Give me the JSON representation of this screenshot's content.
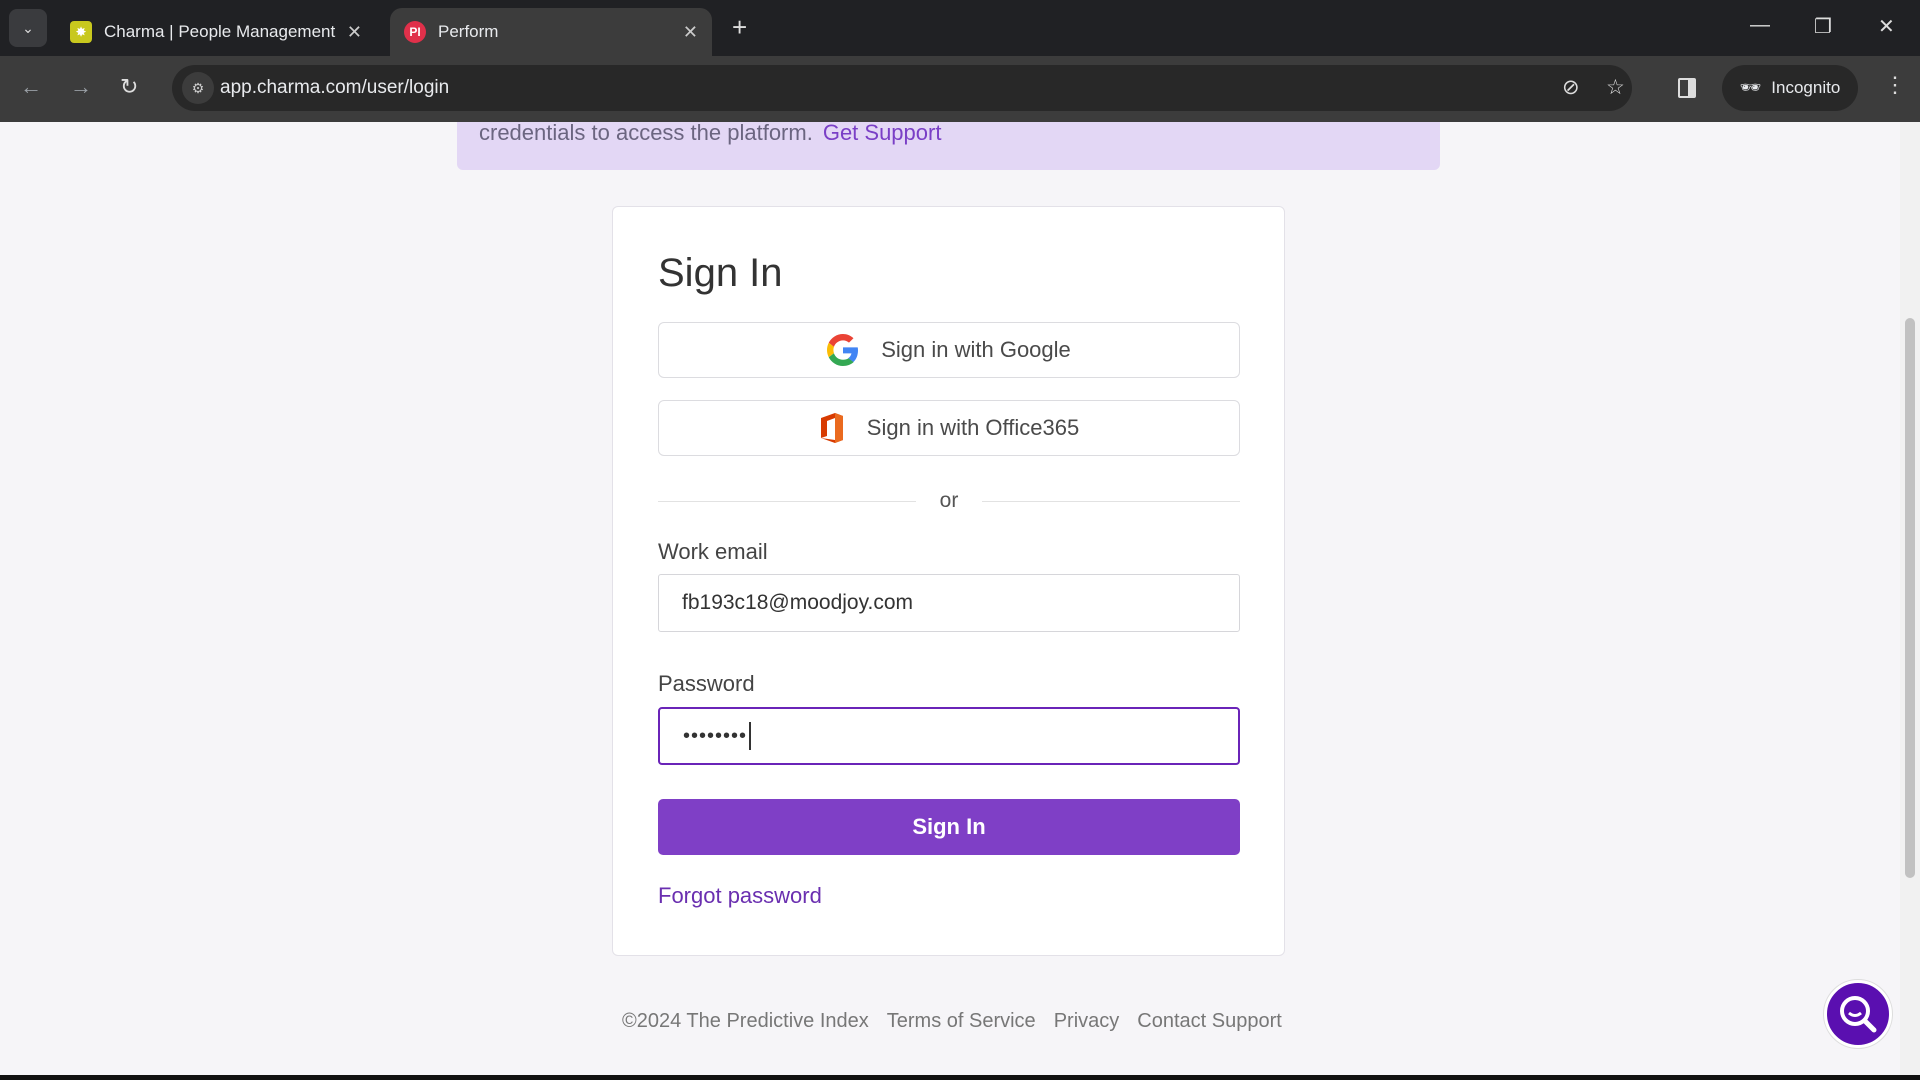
{
  "browser": {
    "tabs": [
      {
        "title": "Charma | People Management S",
        "favicon": "charma-icon",
        "active": false
      },
      {
        "title": "Perform",
        "favicon": "PI",
        "active": true
      }
    ],
    "url": "app.charma.com/user/login",
    "incognito_label": "Incognito"
  },
  "banner": {
    "text": "credentials to access the platform.",
    "link": "Get Support"
  },
  "login": {
    "title": "Sign In",
    "google_label": "Sign in with Google",
    "office_label": "Sign in with Office365",
    "divider": "or",
    "email_label": "Work email",
    "email_value": "fb193c18@moodjoy.com",
    "password_label": "Password",
    "password_value": "••••••••",
    "submit_label": "Sign In",
    "forgot_label": "Forgot password"
  },
  "footer": {
    "copyright": "©2024 The Predictive Index",
    "links": [
      "Terms of Service",
      "Privacy",
      "Contact Support"
    ]
  },
  "colors": {
    "accent": "#7f3fc6",
    "banner": "#e3d7f5",
    "chat": "#5a0fb0"
  }
}
